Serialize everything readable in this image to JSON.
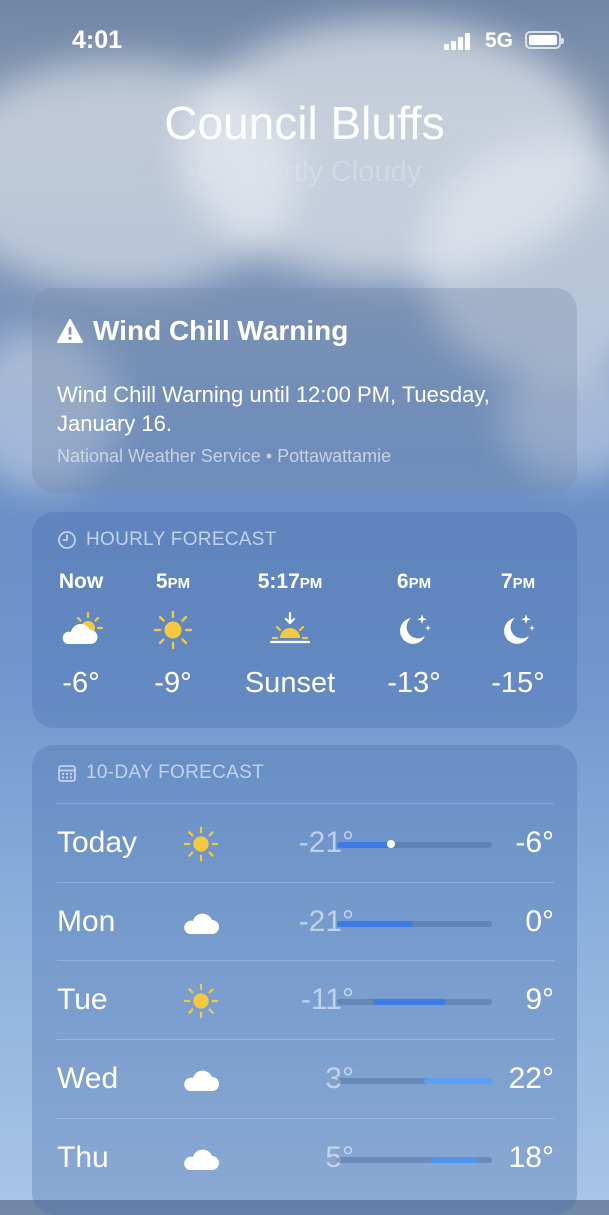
{
  "status_bar": {
    "time": "4:01",
    "network": "5G"
  },
  "location": {
    "city": "Council Bluffs",
    "summary": "-6°  |  Partly Cloudy"
  },
  "alert": {
    "title": "Wind Chill Warning",
    "body": "Wind Chill Warning until 12:00 PM, Tuesday, January 16.",
    "source": "National Weather Service • Pottawattamie"
  },
  "hourly": {
    "header": "HOURLY FORECAST",
    "items": [
      {
        "time": "Now",
        "suffix": "",
        "icon": "partly-cloudy-icon",
        "value": "-6°"
      },
      {
        "time": "5",
        "suffix": "PM",
        "icon": "sun-icon",
        "value": "-9°"
      },
      {
        "time": "5:17",
        "suffix": "PM",
        "icon": "sunset-icon",
        "value": "Sunset"
      },
      {
        "time": "6",
        "suffix": "PM",
        "icon": "moon-stars-icon",
        "value": "-13°"
      },
      {
        "time": "7",
        "suffix": "PM",
        "icon": "moon-stars-icon",
        "value": "-15°"
      }
    ]
  },
  "daily": {
    "header": "10-DAY FORECAST",
    "range_low": -21,
    "range_high": 22,
    "days": [
      {
        "day": "Today",
        "icon": "sun-icon",
        "low": "-21°",
        "high": "-6°",
        "low_n": -21,
        "high_n": -6,
        "current_n": -6,
        "bar_color": "#3a7be8"
      },
      {
        "day": "Mon",
        "icon": "cloud-icon",
        "low": "-21°",
        "high": "0°",
        "low_n": -21,
        "high_n": 0,
        "bar_color": "#3a7be8"
      },
      {
        "day": "Tue",
        "icon": "sun-icon",
        "low": "-11°",
        "high": "9°",
        "low_n": -11,
        "high_n": 9,
        "bar_color": "#3a7be8"
      },
      {
        "day": "Wed",
        "icon": "cloud-icon",
        "low": "3°",
        "high": "22°",
        "low_n": 3,
        "high_n": 22,
        "bar_color": "#5aa0f0"
      },
      {
        "day": "Thu",
        "icon": "cloud-icon",
        "low": "5°",
        "high": "18°",
        "low_n": 5,
        "high_n": 18,
        "bar_color": "#4f95ee"
      }
    ]
  }
}
